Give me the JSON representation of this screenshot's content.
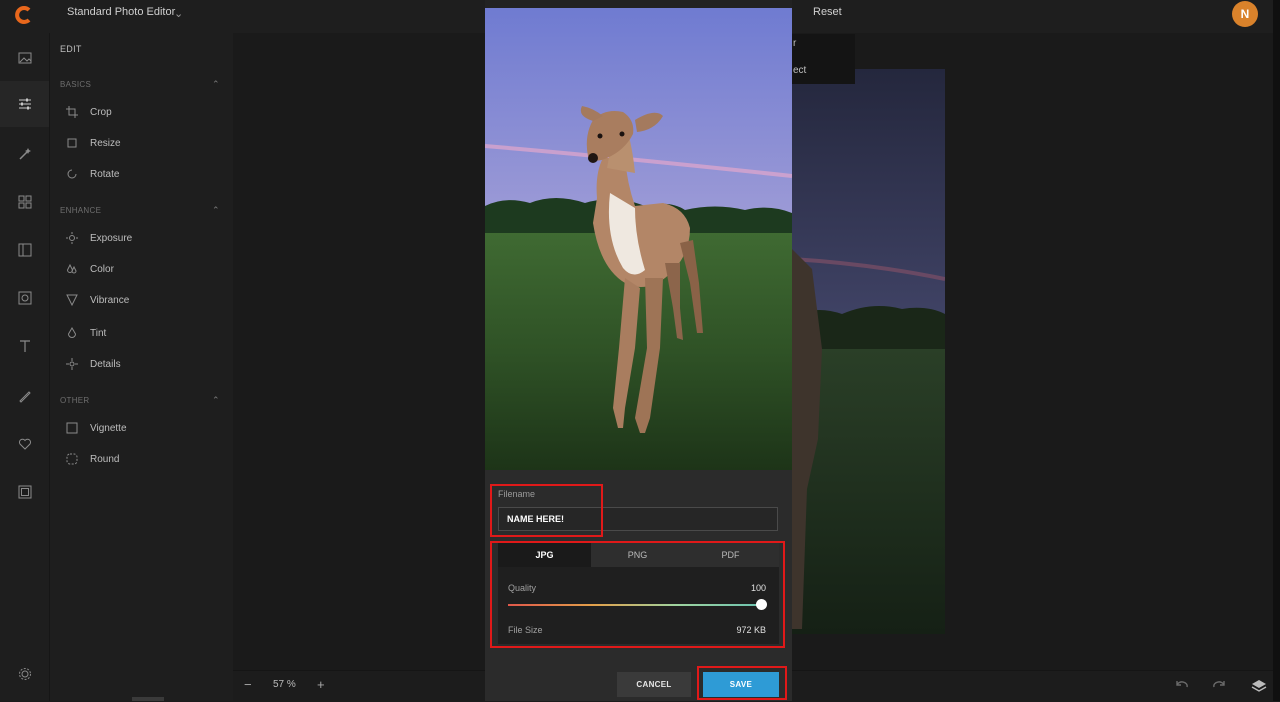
{
  "header": {
    "app_title": "Standard Photo Editor",
    "reset_label": "Reset",
    "avatar_initial": "N"
  },
  "sidebar": {
    "edit_label": "EDIT",
    "sections": [
      {
        "title": "BASICS",
        "items": [
          "Crop",
          "Resize",
          "Rotate"
        ]
      },
      {
        "title": "ENHANCE",
        "items": [
          "Exposure",
          "Color",
          "Vibrance",
          "Tint",
          "Details"
        ]
      },
      {
        "title": "OTHER",
        "items": [
          "Vignette",
          "Round"
        ]
      }
    ]
  },
  "popup_menu": {
    "items": [
      "r",
      "ect"
    ]
  },
  "bottombar": {
    "zoom_minus": "−",
    "zoom_value": "57 %",
    "zoom_plus": "+"
  },
  "save_dialog": {
    "filename_label": "Filename",
    "filename_value": "NAME HERE!",
    "formats": [
      "JPG",
      "PNG",
      "PDF"
    ],
    "selected_format": "JPG",
    "quality_label": "Quality",
    "quality_value": "100",
    "file_size_label": "File Size",
    "file_size_value": "972 KB",
    "cancel_label": "CANCEL",
    "save_label": "SAVE"
  },
  "colors": {
    "accent": "#2e9bd6",
    "avatar": "#d9822b",
    "highlight": "#e01919"
  }
}
